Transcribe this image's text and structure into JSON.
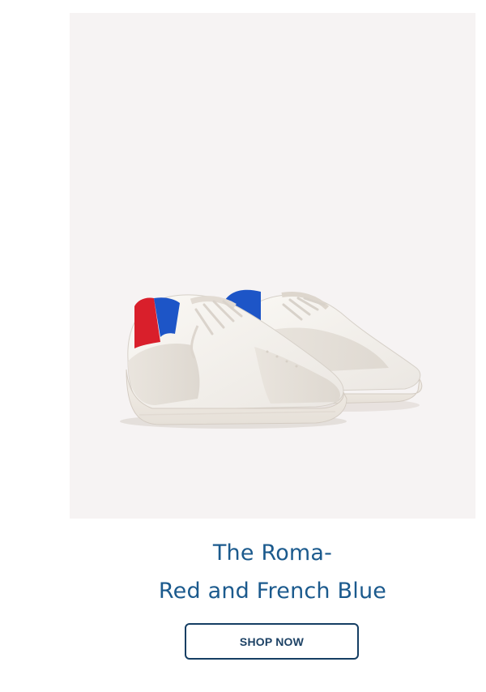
{
  "product": {
    "image_alt": "The Roma sneakers in Red and French Blue",
    "title_line_1": "The Roma-",
    "title_line_2": "Red and French Blue",
    "cta_label": "SHOP NOW",
    "colors": {
      "title": "#1b5a8d",
      "cta_border": "#153e63",
      "image_background": "#f6f3f3",
      "accent_red": "#d91f2b",
      "accent_blue": "#1d55c7"
    }
  }
}
